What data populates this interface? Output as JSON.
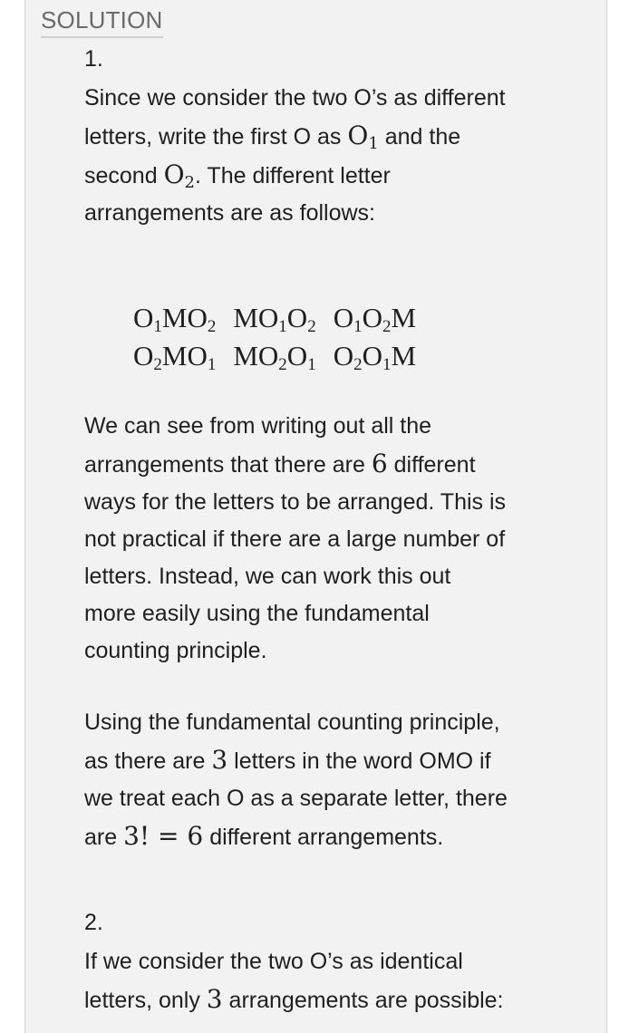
{
  "heading": "SOLUTION",
  "part1": {
    "number": "1.",
    "intro_line1": "Since we consider the two O’s as different",
    "intro_line2_a": "letters, write the first O as ",
    "intro_line2_b": " and the",
    "intro_line3_a": "second ",
    "intro_line3_b": ". The different letter",
    "intro_line4": "arrangements are as follows:",
    "arrangements": [
      [
        "O₁MO₂",
        "MO₁O₂",
        "O₁O₂M"
      ],
      [
        "O₂MO₁",
        "MO₂O₁",
        "O₂O₁M"
      ]
    ],
    "para2_line1": "We can see from writing out all the",
    "para2_line2_a": "arrangements that there are ",
    "para2_count": "6",
    "para2_line2_b": " different",
    "para2_line3": "ways for the letters to be arranged. This is",
    "para2_line4": "not practical if there are a large number of",
    "para2_line5": "letters. Instead, we can work this out",
    "para2_line6": "more easily using the fundamental",
    "para2_line7": "counting principle.",
    "para3_line1": "Using the fundamental counting principle,",
    "para3_line2_a": "as there are ",
    "para3_letters": "3",
    "para3_line2_b": " letters in the word OMO if",
    "para3_line3": "we treat each O as a separate letter, there",
    "para3_line4_a": "are ",
    "para3_expr": "3! = 6",
    "para3_line4_b": " different arrangements."
  },
  "part2": {
    "number": "2.",
    "line1": "If we consider the two O’s as identical",
    "line2_a": "letters, only ",
    "count": "3",
    "line2_b": " arrangements are possible:"
  }
}
